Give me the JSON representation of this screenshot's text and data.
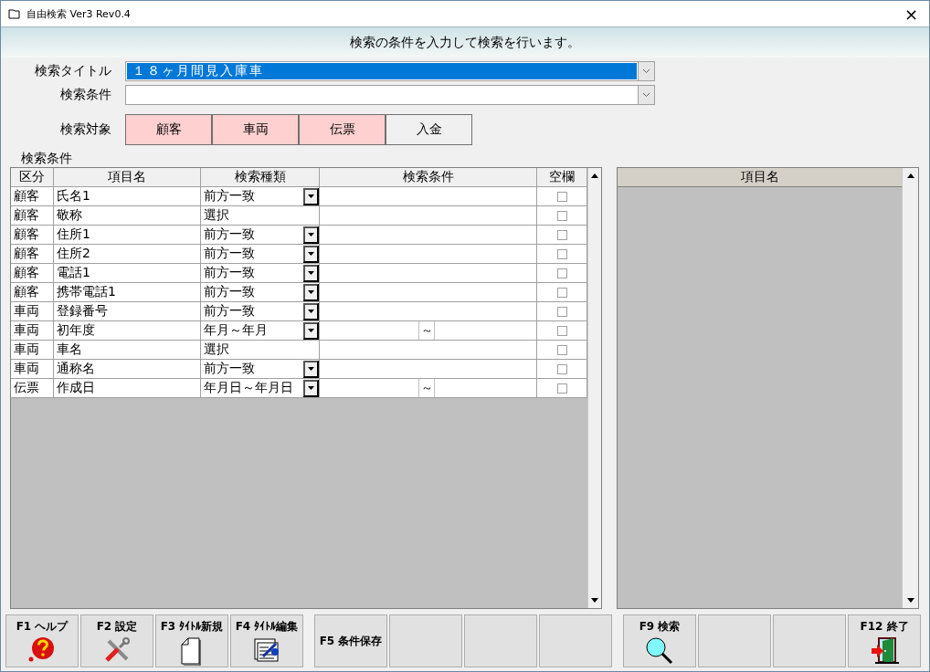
{
  "window": {
    "title": "自由検索 Ver3 Rev0.4",
    "close": "×"
  },
  "header": {
    "message": "検索の条件を入力して検索を行います。"
  },
  "form": {
    "title_field": {
      "label": "検索タイトル",
      "value": "１８ヶ月間見入庫車",
      "selected": true
    },
    "condition_field": {
      "label": "検索条件",
      "selected": false
    },
    "targets_label": "検索対象",
    "targets": [
      {
        "label": "顧客",
        "selected": true
      },
      {
        "label": "車両",
        "selected": true
      },
      {
        "label": "伝票",
        "selected": true
      },
      {
        "label": "入金",
        "selected": false
      }
    ]
  },
  "grid": {
    "section_label": "検索条件",
    "columns": [
      "区分",
      "項目名",
      "検索種類",
      "検索条件",
      "空欄"
    ],
    "rows": [
      {
        "category": "顧客",
        "item": "氏名1",
        "match": "前方一致",
        "kind": "dropdown",
        "checked": false
      },
      {
        "category": "顧客",
        "item": "敬称",
        "match": "選択",
        "kind": "plain",
        "checked": false
      },
      {
        "category": "顧客",
        "item": "住所1",
        "match": "前方一致",
        "kind": "dropdown",
        "checked": false
      },
      {
        "category": "顧客",
        "item": "住所2",
        "match": "前方一致",
        "kind": "dropdown",
        "checked": false
      },
      {
        "category": "顧客",
        "item": "電話1",
        "match": "前方一致",
        "kind": "dropdown",
        "checked": false
      },
      {
        "category": "顧客",
        "item": "携帯電話1",
        "match": "前方一致",
        "kind": "dropdown",
        "checked": false
      },
      {
        "category": "車両",
        "item": "登録番号",
        "match": "前方一致",
        "kind": "dropdown",
        "checked": false
      },
      {
        "category": "車両",
        "item": "初年度",
        "match": "年月～年月",
        "kind": "dropdown",
        "range_separator": "～",
        "checked": false
      },
      {
        "category": "車両",
        "item": "車名",
        "match": "選択",
        "kind": "plain",
        "checked": false
      },
      {
        "category": "車両",
        "item": "通称名",
        "match": "前方一致",
        "kind": "dropdown",
        "checked": false
      },
      {
        "category": "伝票",
        "item": "作成日",
        "match": "年月日～年月日",
        "kind": "dropdown",
        "range_separator": "～",
        "checked": false
      }
    ]
  },
  "result_panel": {
    "column": "項目名"
  },
  "function_key_groups": [
    [
      {
        "label": "F1 ヘルプ",
        "kind": "help"
      },
      {
        "label": "F2 設定",
        "kind": "tools"
      },
      {
        "label": "F3 ﾀｲﾄﾙ新規",
        "kind": "new-document"
      },
      {
        "label": "F4 ﾀｲﾄﾙ編集",
        "kind": "edit-document"
      }
    ],
    [
      {
        "label": "F5 条件保存",
        "kind": "text"
      },
      {
        "kind": "blank"
      },
      {
        "kind": "blank"
      },
      {
        "kind": "blank"
      }
    ],
    [
      {
        "label": "F9 検索",
        "kind": "search"
      },
      {
        "kind": "blank"
      },
      {
        "kind": "blank"
      },
      {
        "label": "F12 終了",
        "kind": "exit"
      }
    ]
  ]
}
